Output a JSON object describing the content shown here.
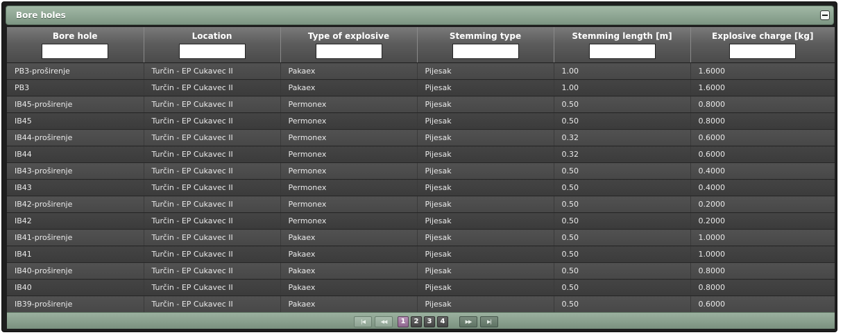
{
  "panel": {
    "title": "Bore holes"
  },
  "table": {
    "columns": [
      "Bore hole",
      "Location",
      "Type of explosive",
      "Stemming type",
      "Stemming length [m]",
      "Explosive charge [kg]"
    ],
    "filters": [
      "",
      "",
      "",
      "",
      "",
      ""
    ],
    "rows": [
      [
        "PB3-proširenje",
        "Turčin - EP Cukavec II",
        "Pakaex",
        "Pijesak",
        "1.00",
        "1.6000"
      ],
      [
        "PB3",
        "Turčin - EP Cukavec II",
        "Pakaex",
        "Pijesak",
        "1.00",
        "1.6000"
      ],
      [
        "IB45-proširenje",
        "Turčin - EP Cukavec II",
        "Permonex",
        "Pijesak",
        "0.50",
        "0.8000"
      ],
      [
        "IB45",
        "Turčin - EP Cukavec II",
        "Permonex",
        "Pijesak",
        "0.50",
        "0.8000"
      ],
      [
        "IB44-proširenje",
        "Turčin - EP Cukavec II",
        "Permonex",
        "Pijesak",
        "0.32",
        "0.6000"
      ],
      [
        "IB44",
        "Turčin - EP Cukavec II",
        "Permonex",
        "Pijesak",
        "0.32",
        "0.6000"
      ],
      [
        "IB43-proširenje",
        "Turčin - EP Cukavec II",
        "Permonex",
        "Pijesak",
        "0.50",
        "0.4000"
      ],
      [
        "IB43",
        "Turčin - EP Cukavec II",
        "Permonex",
        "Pijesak",
        "0.50",
        "0.4000"
      ],
      [
        "IB42-proširenje",
        "Turčin - EP Cukavec II",
        "Permonex",
        "Pijesak",
        "0.50",
        "0.2000"
      ],
      [
        "IB42",
        "Turčin - EP Cukavec II",
        "Permonex",
        "Pijesak",
        "0.50",
        "0.2000"
      ],
      [
        "IB41-proširenje",
        "Turčin - EP Cukavec II",
        "Pakaex",
        "Pijesak",
        "0.50",
        "1.0000"
      ],
      [
        "IB41",
        "Turčin - EP Cukavec II",
        "Pakaex",
        "Pijesak",
        "0.50",
        "1.0000"
      ],
      [
        "IB40-proširenje",
        "Turčin - EP Cukavec II",
        "Pakaex",
        "Pijesak",
        "0.50",
        "0.8000"
      ],
      [
        "IB40",
        "Turčin - EP Cukavec II",
        "Pakaex",
        "Pijesak",
        "0.50",
        "0.8000"
      ],
      [
        "IB39-proširenje",
        "Turčin - EP Cukavec II",
        "Pakaex",
        "Pijesak",
        "0.50",
        "0.6000"
      ]
    ]
  },
  "pager": {
    "first_icon": "first-page-icon",
    "prev_icon": "previous-page-icon",
    "next_icon": "next-page-icon",
    "last_icon": "last-page-icon",
    "pages": [
      "1",
      "2",
      "3",
      "4"
    ],
    "current_page": "1"
  },
  "colors": {
    "accent_green": "#8ba590",
    "current_page": "#a37fa3",
    "row_odd": "#4c4c4c",
    "row_even": "#404040"
  }
}
